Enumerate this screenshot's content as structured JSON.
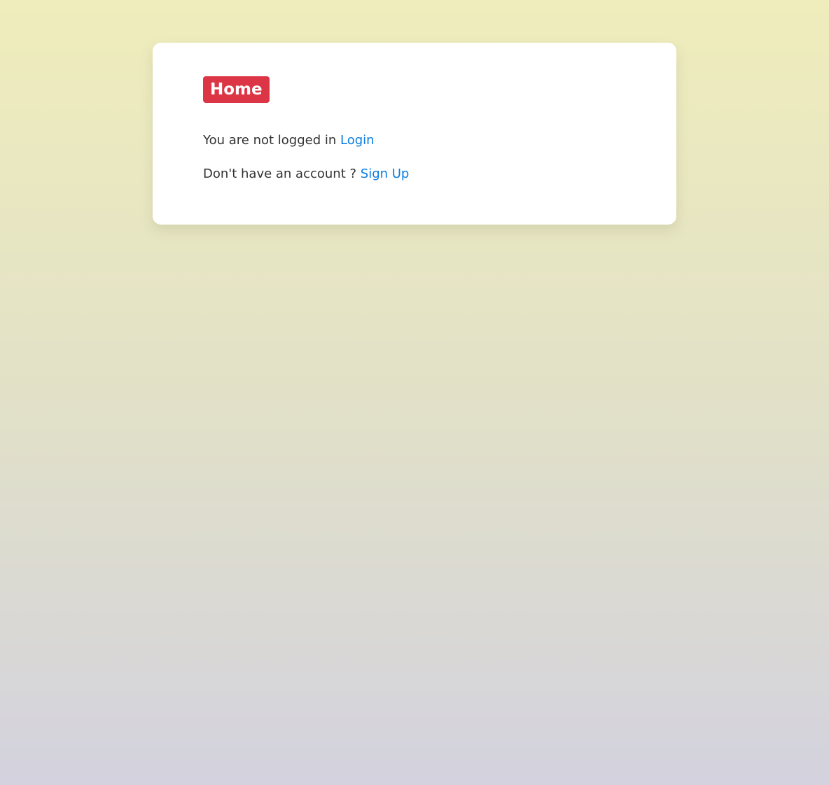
{
  "home": {
    "badge_label": "Home",
    "status_text": "You are not logged in ",
    "login_link": "Login",
    "signup_prompt": "Don't have an account ? ",
    "signup_link": "Sign Up"
  },
  "colors": {
    "badge": "#dc3545",
    "link": "#0a7de0",
    "text": "#333333",
    "card": "#ffffff"
  }
}
